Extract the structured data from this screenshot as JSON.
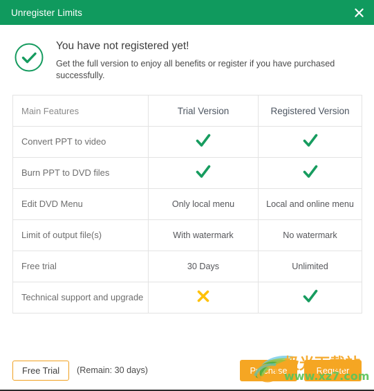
{
  "window": {
    "title": "Unregister Limits",
    "close_icon": "close-icon",
    "accent_green": "#109a5e",
    "accent_orange": "#f5a623"
  },
  "notice": {
    "icon": "check-circle-icon",
    "title": "You have not registered yet!",
    "subtitle": "Get the full version to enjoy all benefits or register if you have purchased successfully."
  },
  "table": {
    "headers": [
      "Main Features",
      "Trial Version",
      "Registered Version"
    ],
    "rows": [
      {
        "feature": "Convert PPT to video",
        "trial": "check",
        "registered": "check"
      },
      {
        "feature": "Burn PPT to DVD files",
        "trial": "check",
        "registered": "check"
      },
      {
        "feature": "Edit DVD Menu",
        "trial": "Only local menu",
        "registered": "Local and online menu"
      },
      {
        "feature": "Limit of output file(s)",
        "trial": "With watermark",
        "registered": "No watermark"
      },
      {
        "feature": "Free trial",
        "trial": "30 Days",
        "registered": "Unlimited"
      },
      {
        "feature": "Technical support and upgrade",
        "trial": "cross",
        "registered": "check"
      }
    ],
    "check_color": "#179c5f",
    "cross_color": "#ffc107"
  },
  "footer": {
    "free_trial_label": "Free Trial",
    "remain_label": "(Remain: 30 days)",
    "purchase_label": "Purchase",
    "register_label": "Register"
  },
  "watermark": {
    "cn_text": "极光下载站",
    "url_text": "www.xz7.com",
    "logo": "swoosh-logo"
  }
}
